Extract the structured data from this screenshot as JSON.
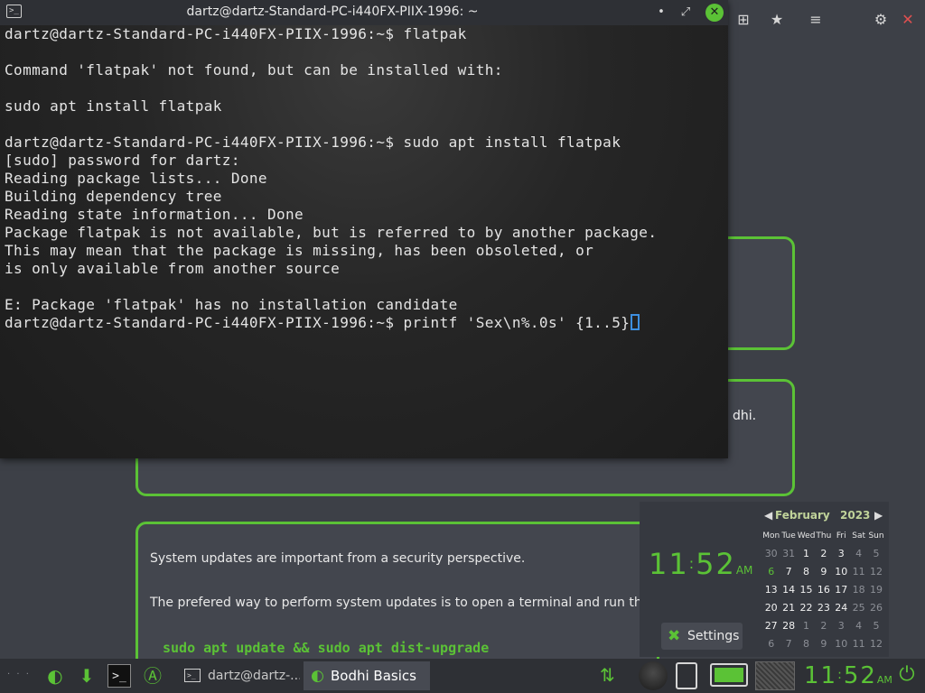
{
  "terminal": {
    "title": "dartz@dartz-Standard-PC-i440FX-PIIX-1996: ~",
    "icon_glyph": ">_",
    "minimize_glyph": "•",
    "maximize_glyph": "⤢",
    "close_glyph": "✕",
    "lines": [
      "dartz@dartz-Standard-PC-i440FX-PIIX-1996:~$ flatpak",
      "",
      "Command 'flatpak' not found, but can be installed with:",
      "",
      "sudo apt install flatpak",
      "",
      "dartz@dartz-Standard-PC-i440FX-PIIX-1996:~$ sudo apt install flatpak",
      "[sudo] password for dartz:",
      "Reading package lists... Done",
      "Building dependency tree",
      "Reading state information... Done",
      "Package flatpak is not available, but is referred to by another package.",
      "This may mean that the package is missing, has been obsoleted, or",
      "is only available from another source",
      "",
      "E: Package 'flatpak' has no installation candidate"
    ],
    "prompt_line": "dartz@dartz-Standard-PC-i440FX-PIIX-1996:~$ printf 'Sex\\n%.0s' {1..5}"
  },
  "background_app": {
    "topbar_icons": [
      "add-icon",
      "bookmark-icon",
      "menu-icon",
      "gear-icon",
      "close-icon"
    ],
    "topbar_glyphs": [
      "⊞",
      "★",
      "≡",
      "⚙",
      "✕"
    ],
    "card2_text": "dhi.",
    "card3_line1": "System updates are important from a security perspective.",
    "card3_line2": "The prefered way to perform system updates is to open a terminal and run the co",
    "card3_command": "sudo apt update && sudo apt dist-upgrade"
  },
  "popup": {
    "clock_hours": "11",
    "clock_minutes": "52",
    "clock_ampm": "AM",
    "settings_label": "Settings",
    "settings_glyph": "✖",
    "calendar": {
      "month": "February",
      "year": "2023",
      "prev_glyph": "◀",
      "next_glyph": "▶",
      "weekdays": [
        "Mon",
        "Tue",
        "Wed",
        "Thu",
        "Fri",
        "Sat",
        "Sun"
      ],
      "weeks": [
        [
          "30",
          "31",
          "1",
          "2",
          "3",
          "4",
          "5"
        ],
        [
          "6",
          "7",
          "8",
          "9",
          "10",
          "11",
          "12"
        ],
        [
          "13",
          "14",
          "15",
          "16",
          "17",
          "18",
          "19"
        ],
        [
          "20",
          "21",
          "22",
          "23",
          "24",
          "25",
          "26"
        ],
        [
          "27",
          "28",
          "1",
          "2",
          "3",
          "4",
          "5"
        ],
        [
          "6",
          "7",
          "8",
          "9",
          "10",
          "11",
          "12"
        ]
      ],
      "today": "6"
    }
  },
  "taskbar": {
    "launchers": [
      "bodhi-icon",
      "download-icon",
      "terminal-icon",
      "app-store-icon"
    ],
    "launcher_glyphs": [
      "◐",
      "⬇",
      ">_",
      "Ⓐ"
    ],
    "tasks": [
      {
        "label": "dartz@dartz-...",
        "icon": "terminal-icon"
      },
      {
        "label": "Bodhi Basics",
        "icon": "bodhi-icon"
      }
    ],
    "tray_clock_hours": "11",
    "tray_clock_minutes": "52",
    "tray_clock_ampm": "AM",
    "tray_arrows_glyph": "⇅",
    "power_glyph": "⏻",
    "dots": "· · ·"
  },
  "colors": {
    "accent": "#5bc236",
    "terminal_bg": "#1e1e1e",
    "desktop_bg": "#3d4047",
    "cursor": "#3d8fe0"
  }
}
